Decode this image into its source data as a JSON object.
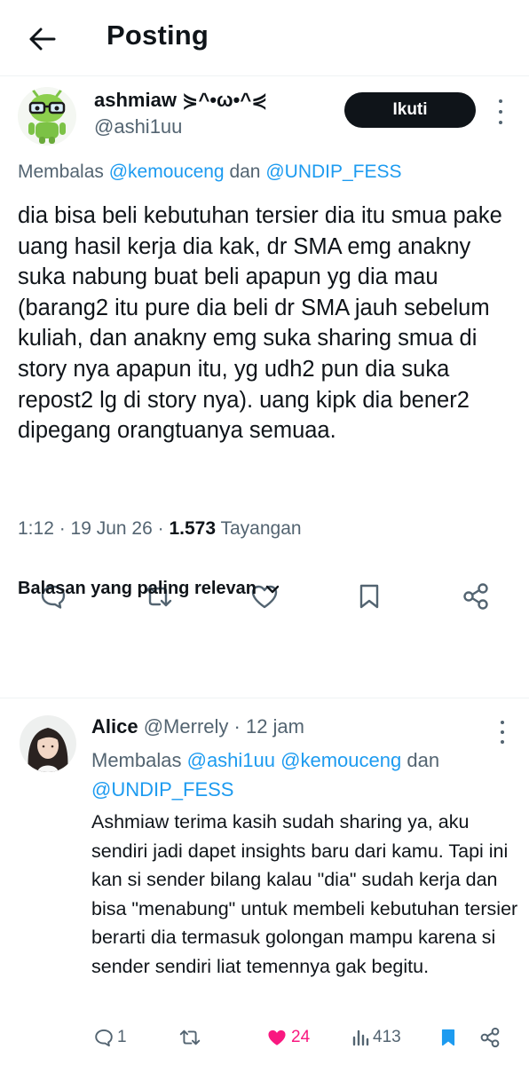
{
  "header": {
    "title": "Posting"
  },
  "tweet": {
    "author_name": "ashmiaw ⋟^•ω•^⋞",
    "author_handle": "@ashi1uu",
    "follow_label": "Ikuti",
    "replying_prefix": "Membalas",
    "replying_to_1": "@kemouceng",
    "replying_and": "dan",
    "replying_to_2": "@UNDIP_FESS",
    "text": "dia bisa beli kebutuhan tersier dia itu smua pake uang hasil kerja dia kak, dr SMA emg anakny suka nabung buat beli apapun yg dia mau (barang2 itu pure dia beli dr SMA jauh sebelum kuliah, dan anakny emg suka sharing smua di story nya apapun itu, yg udh2 pun dia suka repost2 lg di story nya). uang kipk dia bener2 dipegang orangtuanya semuaa.",
    "time": "1:12",
    "date": "19 Jun 26",
    "views": "1.573",
    "views_label": "Tayangan"
  },
  "sort_label": "Balasan yang paling relevan",
  "reply": {
    "author_name": "Alice",
    "author_handle": "@Merrely",
    "time": "12 jam",
    "replying_prefix": "Membalas",
    "replying_to_1": "@ashi1uu",
    "replying_to_2": "@kemouceng",
    "replying_and": "dan",
    "replying_to_3": "@UNDIP_FESS",
    "text": "Ashmiaw terima kasih sudah sharing ya, aku sendiri jadi dapet insights baru dari kamu. Tapi ini kan si sender bilang kalau \"dia\" sudah kerja dan bisa \"menabung\" untuk membeli kebutuhan tersier berarti dia termasuk golongan mampu karena si sender sendiri liat temennya gak begitu.",
    "reply_count": "1",
    "like_count": "24",
    "view_count": "413"
  },
  "colors": {
    "accent": "#1d9bf0",
    "like": "#f91880",
    "secondary_text": "#536471",
    "follow_bg": "#0f1419"
  },
  "icons": [
    "back-arrow-icon",
    "more-vertical-icon",
    "reply-icon",
    "retweet-icon",
    "like-icon",
    "bookmark-icon",
    "share-icon",
    "chevron-down-icon",
    "views-icon"
  ]
}
